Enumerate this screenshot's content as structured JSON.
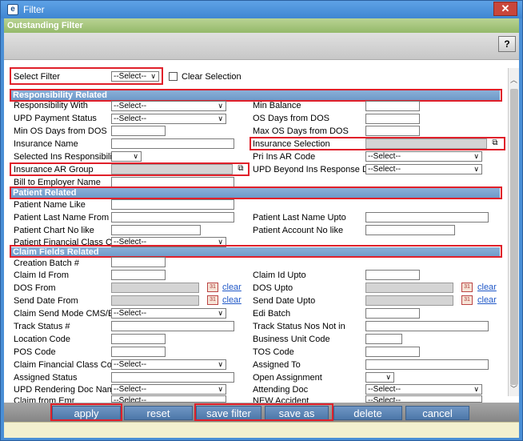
{
  "window": {
    "title": "Filter",
    "subtitle": "Outstanding Filter",
    "help_label": "?",
    "close_label": "✕"
  },
  "top": {
    "select_filter_label": "Select Filter",
    "select_filter_value": "--Select--",
    "clear_selection_label": "Clear Selection"
  },
  "sections": {
    "responsibility": "Responsibility Related",
    "patient": "Patient Related",
    "claim": "Claim Fields Related"
  },
  "fields": {
    "responsibility_with": {
      "label": "Responsibility With",
      "value": "--Select--"
    },
    "upd_payment_status": {
      "label": "UPD Payment Status",
      "value": "--Select--"
    },
    "min_os_days_from_dos": {
      "label": "Min OS Days from DOS"
    },
    "insurance_name": {
      "label": "Insurance Name"
    },
    "selected_ins_responsibility": {
      "label": "Selected Ins Responsibility"
    },
    "insurance_ar_group": {
      "label": "Insurance AR Group"
    },
    "bill_to_employer_name": {
      "label": "Bill to Employer Name"
    },
    "min_balance": {
      "label": "Min Balance"
    },
    "os_days_from_dos": {
      "label": "OS Days from DOS"
    },
    "max_os_days_from_dos": {
      "label": "Max OS Days from DOS"
    },
    "insurance_selection": {
      "label": "Insurance Selection"
    },
    "pri_ins_ar_code": {
      "label": "Pri Ins AR Code",
      "value": "--Select--"
    },
    "upd_beyond_ins_response_days": {
      "label": "UPD Beyond Ins Response Days",
      "value": "--Select--"
    },
    "patient_name_like": {
      "label": "Patient Name Like"
    },
    "patient_last_name_from": {
      "label": "Patient Last Name From"
    },
    "patient_chart_no_like": {
      "label": "Patient Chart No like"
    },
    "patient_financial_class_code": {
      "label": "Patient Financial Class Code",
      "value": "--Select--"
    },
    "patient_last_name_upto": {
      "label": "Patient Last Name Upto"
    },
    "patient_account_no_like": {
      "label": "Patient Account No like"
    },
    "creation_batch": {
      "label": "Creation Batch #"
    },
    "claim_id_from": {
      "label": "Claim Id From"
    },
    "dos_from": {
      "label": "DOS From"
    },
    "send_date_from": {
      "label": "Send Date From"
    },
    "claim_send_mode": {
      "label": "Claim Send Mode CMS/EDI",
      "value": "--Select--"
    },
    "track_status": {
      "label": "Track Status #"
    },
    "location_code": {
      "label": "Location Code"
    },
    "pos_code": {
      "label": "POS Code"
    },
    "claim_financial_class_code": {
      "label": "Claim Financial Class Code",
      "value": "--Select--"
    },
    "assigned_status": {
      "label": "Assigned Status"
    },
    "upd_rendering_doc_name": {
      "label": "UPD Rendering Doc Name",
      "value": "--Select--"
    },
    "claim_from_emr": {
      "label": "Claim from Emr",
      "value": "--Select--"
    },
    "claim_id_upto": {
      "label": "Claim Id Upto"
    },
    "dos_upto": {
      "label": "DOS Upto"
    },
    "send_date_upto": {
      "label": "Send Date Upto"
    },
    "edi_batch": {
      "label": "Edi Batch"
    },
    "track_status_nos_not_in": {
      "label": "Track Status Nos Not in"
    },
    "business_unit_code": {
      "label": "Business Unit Code"
    },
    "tos_code": {
      "label": "TOS Code"
    },
    "assigned_to": {
      "label": "Assigned To"
    },
    "open_assignment": {
      "label": "Open Assignment"
    },
    "attending_doc": {
      "label": "Attending Doc",
      "value": "--Select--"
    },
    "new_accident": {
      "label": "NEW Accident",
      "value": "--Select--"
    }
  },
  "clear_link": "clear",
  "buttons": {
    "apply": "apply",
    "reset": "reset",
    "save_filter": "save filter",
    "save_as": "save as",
    "delete": "delete",
    "cancel": "cancel"
  },
  "colors": {
    "titlebar": "#3f86d2",
    "section": "#6b97c8",
    "highlight": "#e0202a",
    "buttons": "#4d77a9",
    "subtitle": "#94b96a"
  },
  "icons": {
    "app": "filter-app-icon",
    "binoculars": "binoculars-icon",
    "calendar": "calendar-icon"
  }
}
